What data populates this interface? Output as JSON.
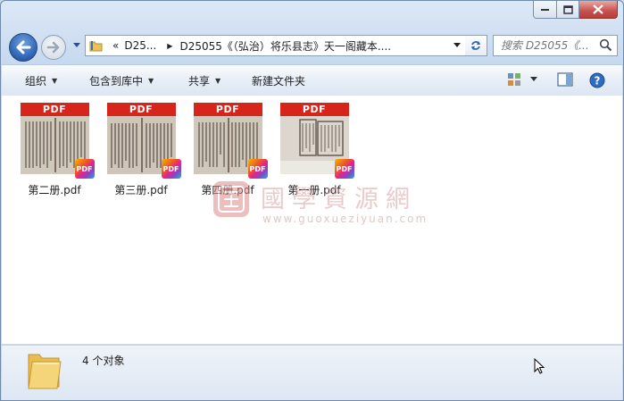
{
  "window": {
    "caption_buttons": [
      "minimize",
      "maximize",
      "close"
    ]
  },
  "address_bar": {
    "overflow": "«",
    "crumbs": [
      "D25...",
      "D25055《（弘治）将乐县志》天一阁藏本...."
    ]
  },
  "search": {
    "placeholder": "搜索 D25055《..."
  },
  "toolbar": {
    "organize": "组织",
    "include_library": "包含到库中",
    "share": "共享",
    "new_folder": "新建文件夹"
  },
  "files": [
    {
      "name": "第二册.pdf",
      "label": "PDF",
      "badge": "PDF"
    },
    {
      "name": "第三册.pdf",
      "label": "PDF",
      "badge": "PDF"
    },
    {
      "name": "第四册.pdf",
      "label": "PDF",
      "badge": "PDF"
    },
    {
      "name": "第一册.pdf",
      "label": "PDF",
      "badge": "PDF"
    }
  ],
  "watermark": {
    "text": "國學資源網",
    "url": "www.guoxueziyuan.com"
  },
  "status": {
    "count": "4 个对象"
  },
  "colors": {
    "pdf_red": "#d7251c",
    "window_frame": "#c7d9ef",
    "close_red": "#c75050"
  }
}
